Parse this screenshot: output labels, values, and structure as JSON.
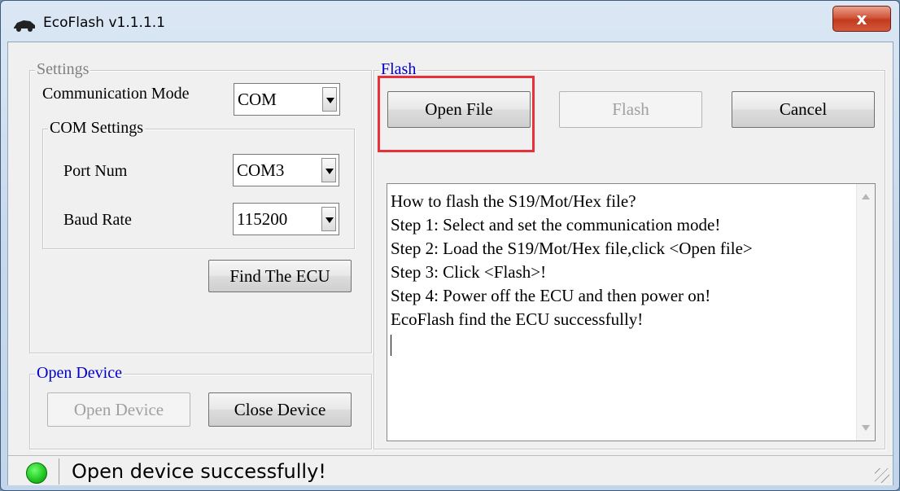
{
  "window": {
    "title": "EcoFlash v1.1.1.1",
    "close_label": "x"
  },
  "settings": {
    "legend": "Settings",
    "comm_mode_label": "Communication Mode",
    "comm_mode_value": "COM",
    "com_settings": {
      "legend": "COM Settings",
      "port_label": "Port Num",
      "port_value": "COM3",
      "baud_label": "Baud Rate",
      "baud_value": "115200"
    },
    "find_ecu_label": "Find The ECU"
  },
  "open_device": {
    "legend": "Open Device",
    "open_label": "Open Device",
    "close_label": "Close Device"
  },
  "flash": {
    "legend": "Flash",
    "open_file_label": "Open File",
    "flash_label": "Flash",
    "cancel_label": "Cancel",
    "log_lines": [
      "How to flash the S19/Mot/Hex file?",
      "Step 1: Select and set the communication mode!",
      "Step 2: Load the S19/Mot/Hex file,click <Open file>",
      "Step 3: Click <Flash>!",
      "Step 4: Power off the ECU and then power on!",
      "EcoFlash find the ECU successfully!"
    ]
  },
  "status": {
    "text": "Open device successfully!",
    "led_color": "#1ec41e"
  },
  "colors": {
    "group_legend_blue": "#0000cc",
    "group_legend_gray": "#808080",
    "highlight": "#e8303a"
  },
  "icons": {
    "app": "car-icon",
    "close": "close-icon",
    "dropdown": "chevron-down-icon",
    "status_led": "status-led-icon",
    "resize": "resize-grip-icon"
  }
}
